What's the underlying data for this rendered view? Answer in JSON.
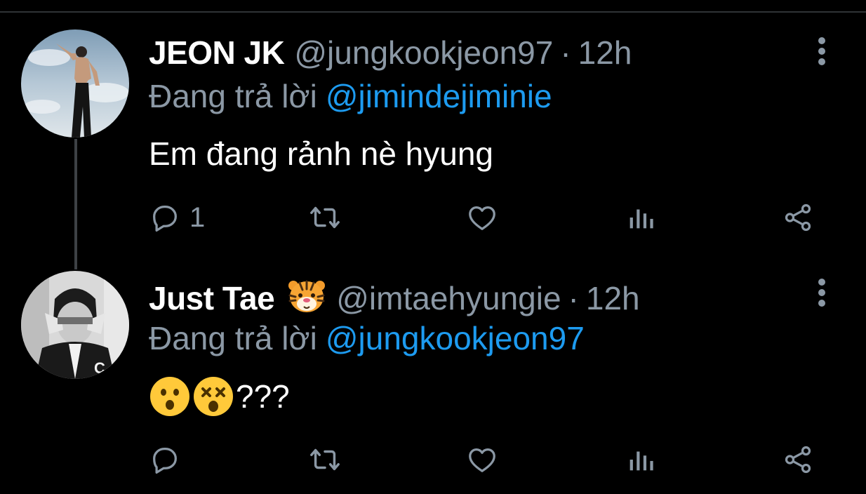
{
  "tweets": [
    {
      "display_name": "JEON JK",
      "handle": "@jungkookjeon97",
      "separator": "·",
      "time": "12h",
      "reply_prefix": "Đang trả lời",
      "reply_to": "@jimindejiminie",
      "text": "Em đang rảnh nè hyung",
      "reply_count": "1",
      "avatar_icon": "user-avatar-shirtless-man",
      "more_icon": "more-vertical-icon"
    },
    {
      "display_name": "Just Tae",
      "name_emoji": "tiger-face-emoji",
      "handle": "@imtaehyungie",
      "separator": "·",
      "time": "12h",
      "reply_prefix": "Đang trả lời",
      "reply_to": "@jungkookjeon97",
      "text_emojis": [
        "hushed-face-emoji",
        "dizzy-face-emoji"
      ],
      "text": "???",
      "reply_count": "",
      "avatar_icon": "user-avatar-man-covering-eyes",
      "more_icon": "more-vertical-icon"
    }
  ],
  "action_icons": [
    "reply-icon",
    "retweet-icon",
    "like-icon",
    "stats-icon",
    "share-icon"
  ],
  "colors": {
    "background": "#000000",
    "primary_text": "#ffffff",
    "secondary_text": "#8b98a5",
    "link": "#1d9bf0",
    "thread_line": "#3d4145"
  }
}
